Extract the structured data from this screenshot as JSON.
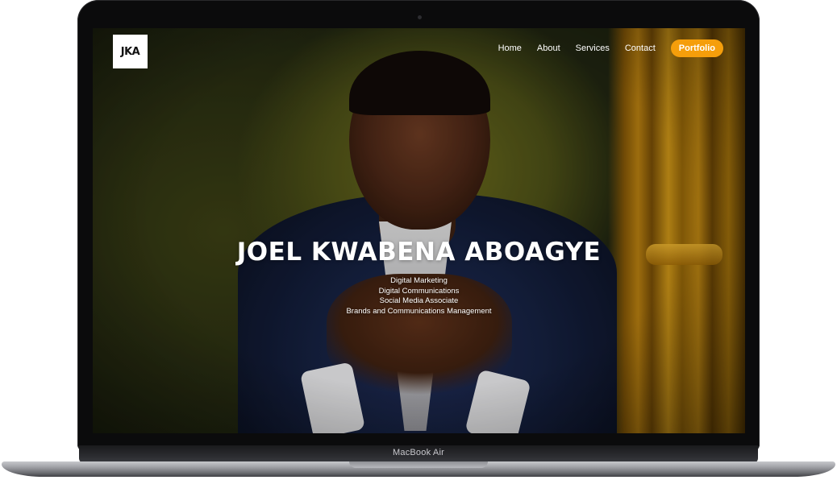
{
  "device": {
    "label": "MacBook Air"
  },
  "site": {
    "logo_text": "JKA",
    "nav": {
      "links": [
        "Home",
        "About",
        "Services",
        "Contact"
      ],
      "cta_label": "Portfolio",
      "cta_color": "#f59e0b"
    },
    "hero": {
      "name": "JOEL KWABENA ABOAGYE",
      "roles": [
        "Digital Marketing",
        "Digital Communications",
        "Social Media Associate",
        "Brands and Communications Management"
      ]
    }
  }
}
